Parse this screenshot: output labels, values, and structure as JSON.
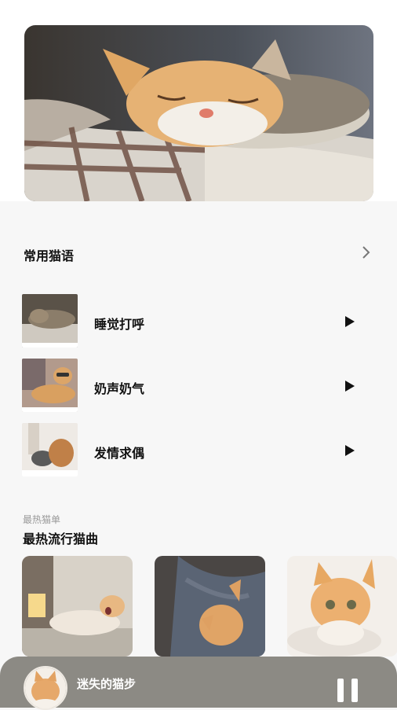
{
  "section": {
    "title": "常用猫语"
  },
  "sounds": [
    {
      "label": "睡觉打呼"
    },
    {
      "label": "奶声奶气"
    },
    {
      "label": "发情求偶"
    }
  ],
  "popular": {
    "subtitle": "最热猫单",
    "title": "最热流行猫曲"
  },
  "player": {
    "song": "迷失的猫步"
  },
  "colors": {
    "player_bg": "#8c8a84",
    "page_bg": "#f7f7f7"
  }
}
